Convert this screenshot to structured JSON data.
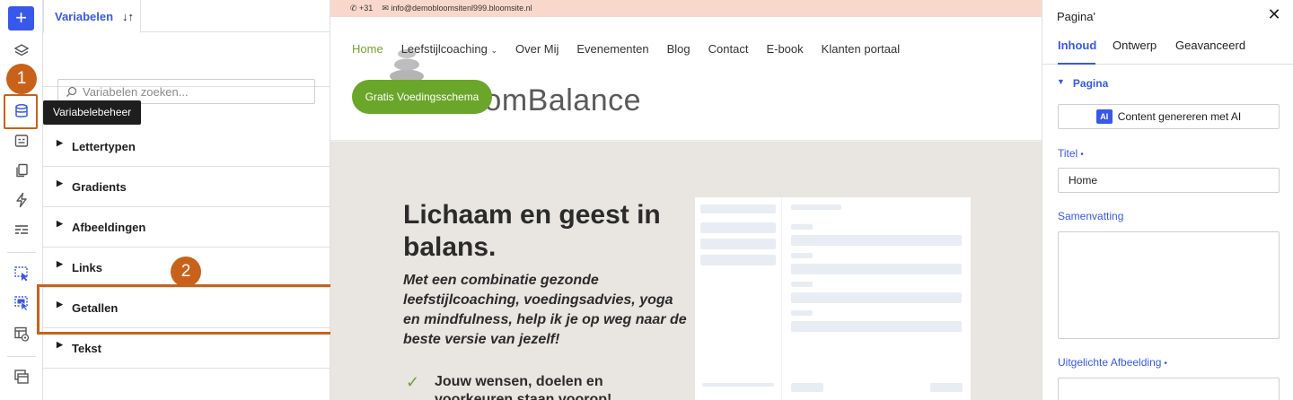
{
  "rail": {
    "add_label": "+",
    "tooltip": "Variabelebeheer",
    "badge1": "1",
    "badge2": "2"
  },
  "variables_panel": {
    "tab_label": "Variabelen",
    "sort_icon": "↓↑",
    "search_placeholder": "Variabelen zoeken...",
    "groups": [
      {
        "label": "Lettertypen"
      },
      {
        "label": "Gradients"
      },
      {
        "label": "Afbeeldingen"
      },
      {
        "label": "Links"
      },
      {
        "label": "Getallen"
      },
      {
        "label": "Tekst"
      }
    ]
  },
  "canvas": {
    "topbar": {
      "phone": "+31",
      "email": "info@demobloomsitenl999.bloomsite.nl"
    },
    "nav": [
      "Home",
      "Leefstijlcoaching",
      "Over Mij",
      "Evenementen",
      "Blog",
      "Contact",
      "E-book",
      "Klanten portaal"
    ],
    "logo_text": "oomBalance",
    "cta": "Gratis Voedingsschema",
    "hero_title": "Lichaam en geest in balans.",
    "hero_sub": "Met een combinatie gezonde leefstijlcoaching, voedingsadvies, yoga en mindfulness, help ik je op weg naar de beste versie van jezelf!",
    "hero_list_item": "Jouw wensen, doelen en voorkeuren staan voorop!"
  },
  "settings": {
    "title": "Pagina'",
    "close": "✕",
    "tabs": [
      "Inhoud",
      "Ontwerp",
      "Geavanceerd"
    ],
    "section": "Pagina",
    "ai_badge": "AI",
    "ai_button": "Content genereren met AI",
    "title_label": "Titel",
    "title_value": "Home",
    "summary_label": "Samenvatting",
    "featured_label": "Uitgelichte Afbeelding",
    "required_dot": "•"
  },
  "colors": {
    "accent": "#3858e9",
    "annotation": "#c8621a",
    "brand_green": "#6aa62a"
  }
}
